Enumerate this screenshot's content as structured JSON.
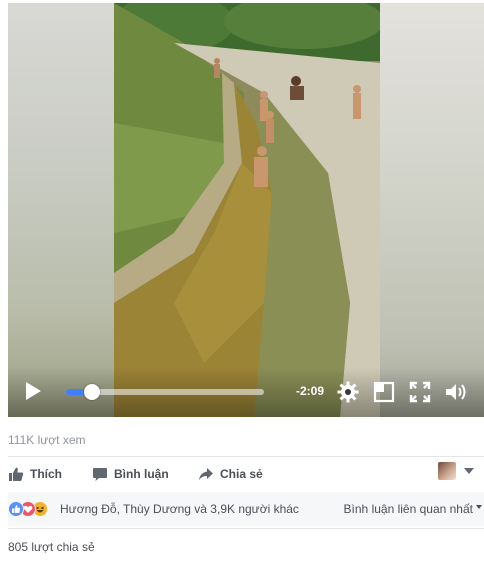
{
  "video": {
    "time_remaining": "-2:09",
    "progress": 0.13,
    "icons": {
      "play": "play-icon",
      "settings": "gear-icon",
      "pip": "picture-in-picture-icon",
      "fullscreen": "fullscreen-icon",
      "volume": "volume-icon"
    }
  },
  "stats": {
    "views": "111K lượt xem"
  },
  "actions": {
    "like_label": "Thích",
    "comment_label": "Bình luận",
    "share_label": "Chia sẻ"
  },
  "reactions": {
    "types": [
      "like",
      "love",
      "haha"
    ],
    "colors": {
      "like": "#5890ff",
      "love": "#f25268",
      "haha": "#f7b125"
    },
    "summary": "Hương Đỗ, Thùy Dương và 3,9K người khác",
    "comment_sort": "Bình luận liên quan nhất"
  },
  "shares": "805 lượt chia sẻ"
}
